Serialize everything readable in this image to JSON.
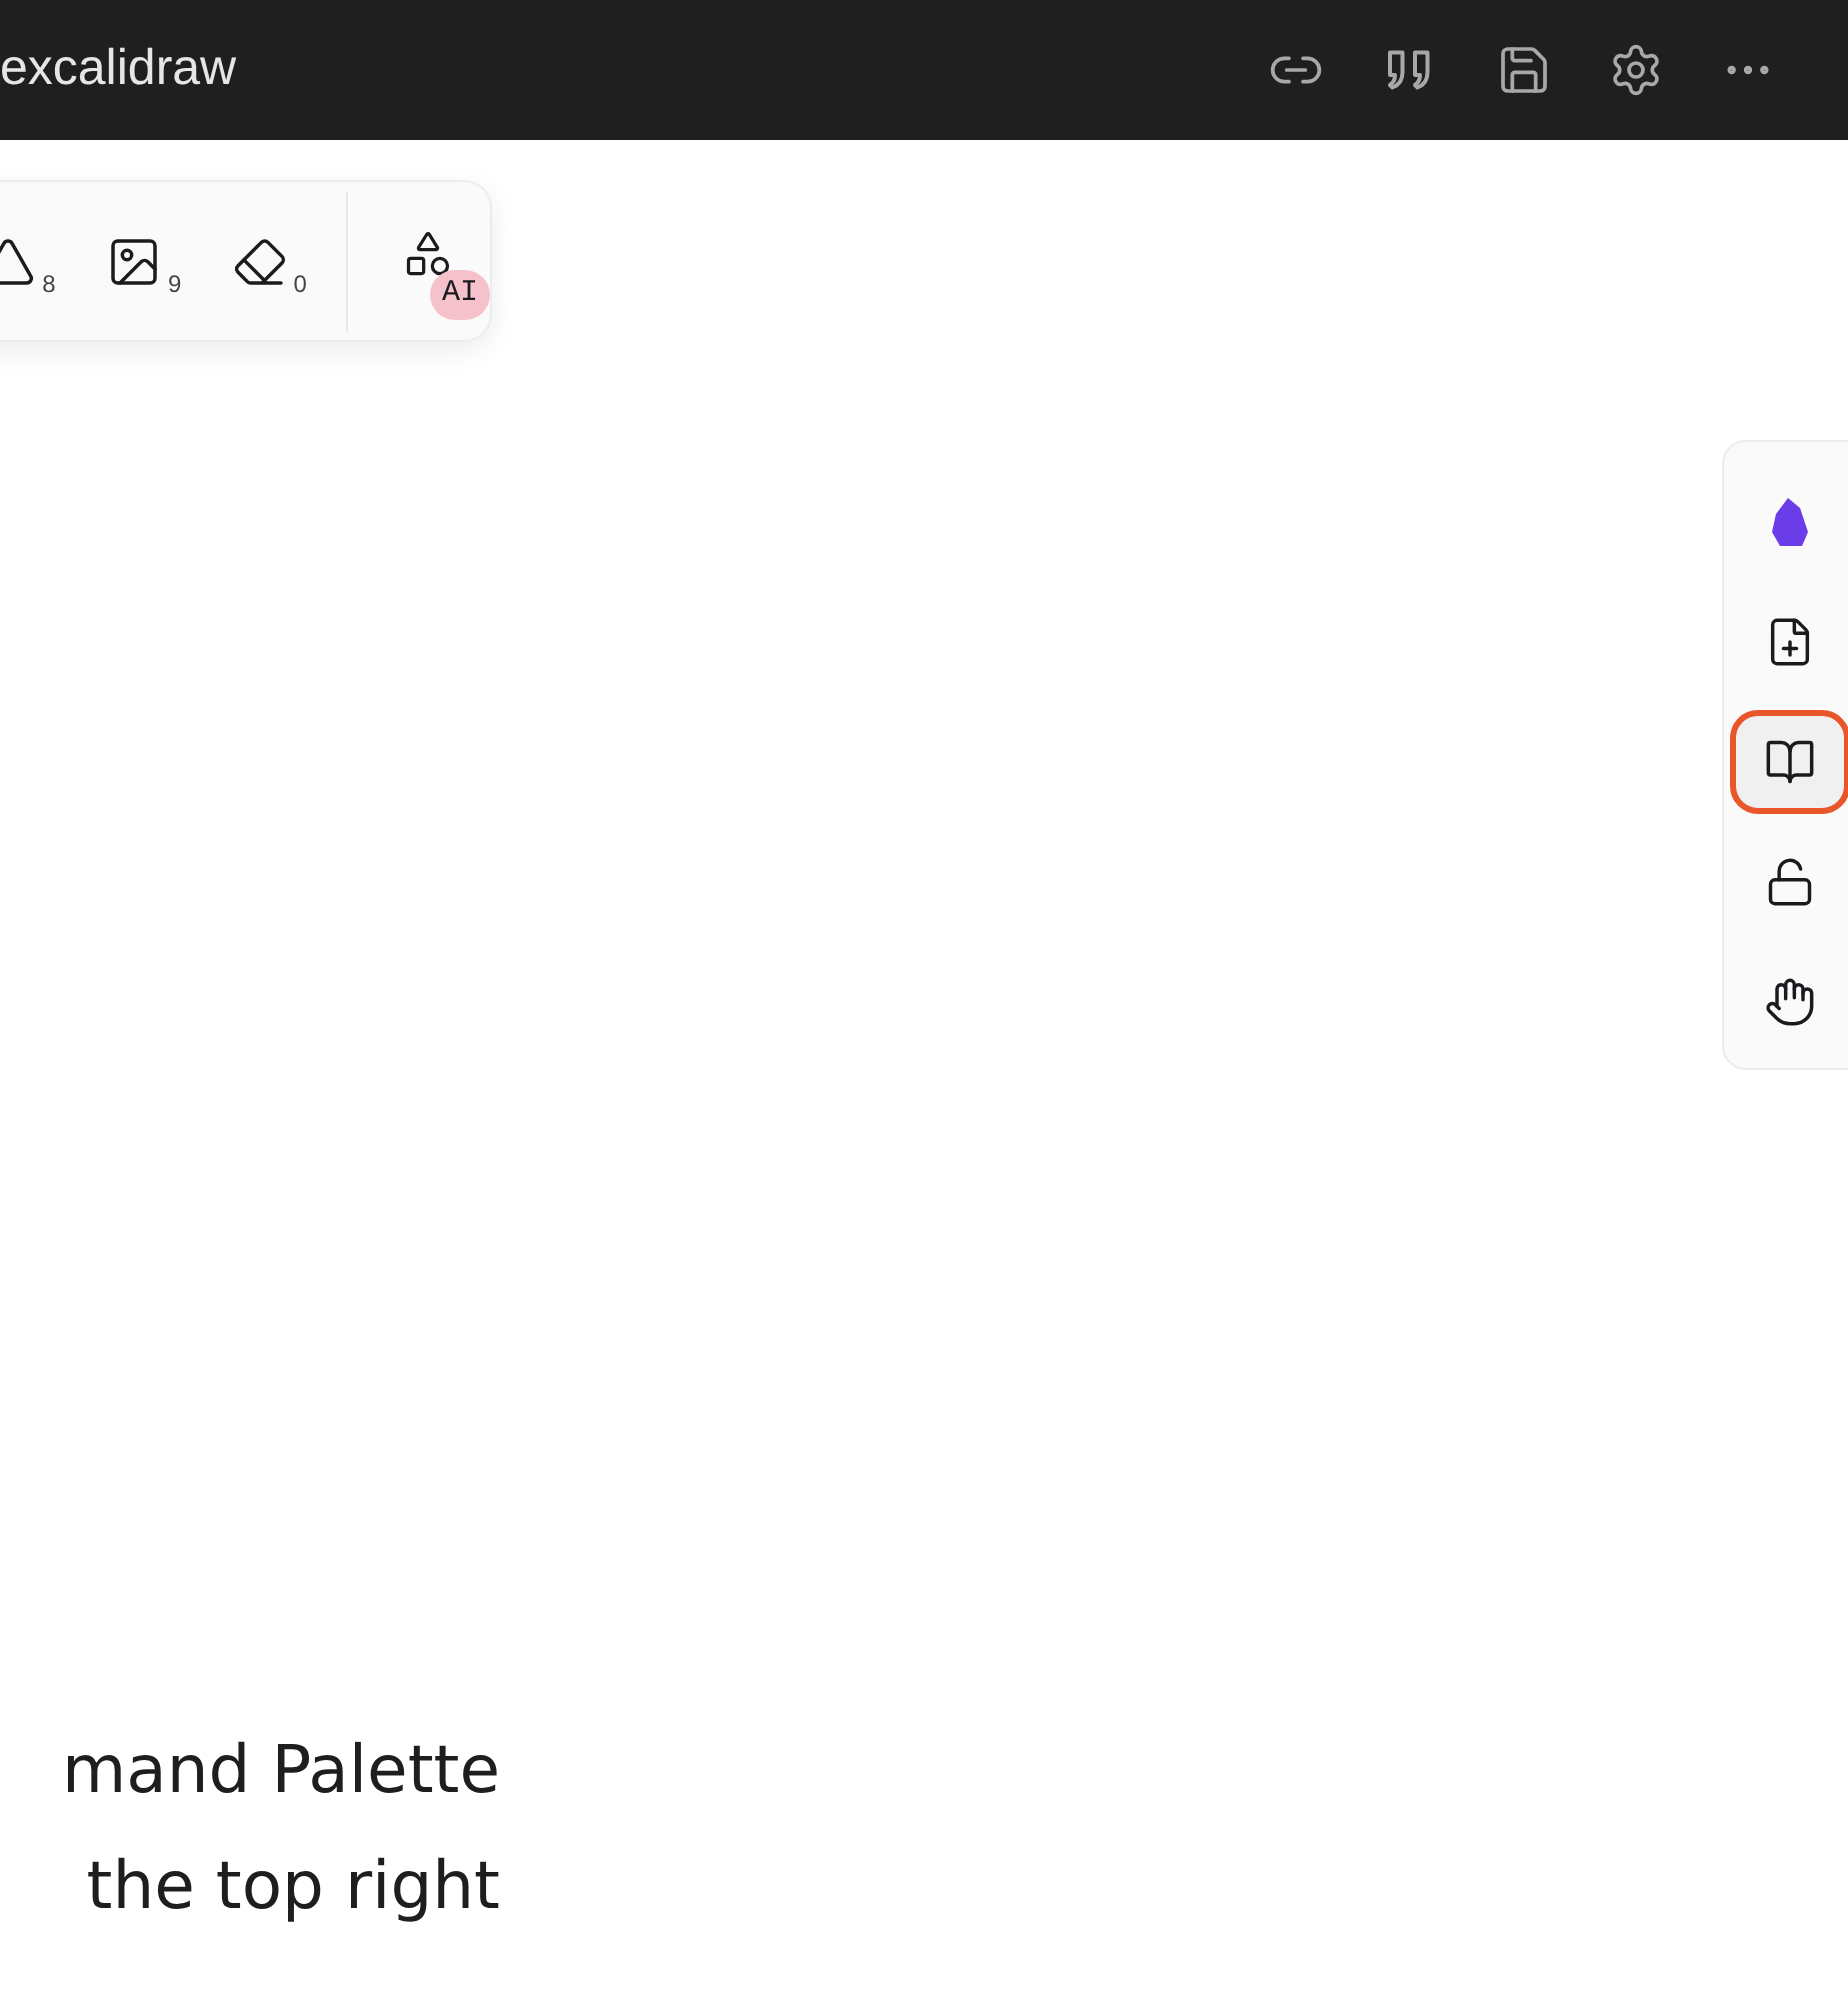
{
  "window": {
    "title": "excalidraw"
  },
  "title_actions": [
    {
      "kind": "link"
    },
    {
      "kind": "quote"
    },
    {
      "kind": "save"
    },
    {
      "kind": "settings"
    },
    {
      "kind": "more"
    }
  ],
  "toolbar": [
    {
      "kind": "shape",
      "key": "8"
    },
    {
      "kind": "image",
      "key": "9"
    },
    {
      "kind": "eraser",
      "key": "0"
    },
    {
      "kind": "ai",
      "badge": "AI"
    }
  ],
  "side_panel": [
    {
      "kind": "logo",
      "selected": false
    },
    {
      "kind": "new-file",
      "selected": false
    },
    {
      "kind": "library",
      "selected": true
    },
    {
      "kind": "lock",
      "selected": false
    },
    {
      "kind": "hand",
      "selected": false
    }
  ],
  "canvas_text": [
    "mand Palette",
    "the top right"
  ]
}
